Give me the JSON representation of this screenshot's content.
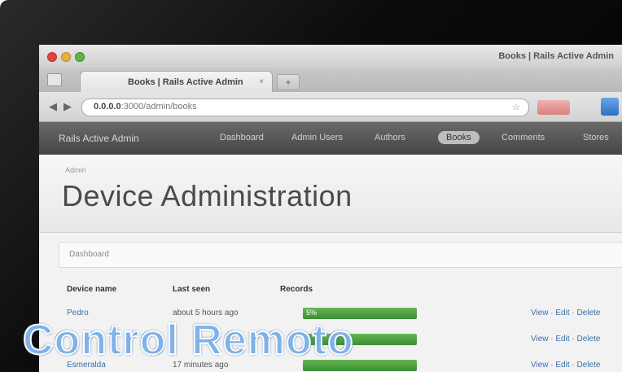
{
  "browser": {
    "window_title": "Books | Rails Active Admin",
    "tab_label": "Books | Rails Active Admin",
    "tab_close": "×",
    "new_tab": "+",
    "url_host": "0.0.0.0",
    "url_path": ":3000/admin/books",
    "back_icon": "◀",
    "forward_icon": "▶",
    "star_icon": "☆"
  },
  "admin": {
    "site_title": "Rails Active Admin",
    "menu": [
      {
        "label": "Dashboard"
      },
      {
        "label": "Admin Users"
      },
      {
        "label": "Authors"
      },
      {
        "label": "Books"
      },
      {
        "label": "Comments"
      },
      {
        "label": "Stores"
      }
    ],
    "active_menu": "Books"
  },
  "page": {
    "breadcrumb": "Admin",
    "title": "Device Administration",
    "scope_label": "Dashboard"
  },
  "table": {
    "headers": [
      "Device name",
      "Last seen",
      "Records"
    ],
    "rows": [
      {
        "name": "Pedro",
        "last_seen": "about 5 hours ago",
        "bar_label": "5%",
        "actions": "View · Edit · Delete"
      },
      {
        "name": "",
        "last_seen": "",
        "bar_label": "",
        "actions": "View · Edit · Delete"
      },
      {
        "name": "Esmeralda",
        "last_seen": "17 minutes ago",
        "bar_label": "",
        "actions": "View · Edit · Delete"
      }
    ]
  },
  "caption": {
    "text": "Control Remoto"
  },
  "colors": {
    "header_bg": "#4f4f4f",
    "bar_green": "#4aa23e",
    "caption_fill": "#7fb2e8",
    "link_blue": "#3c6fa6"
  }
}
